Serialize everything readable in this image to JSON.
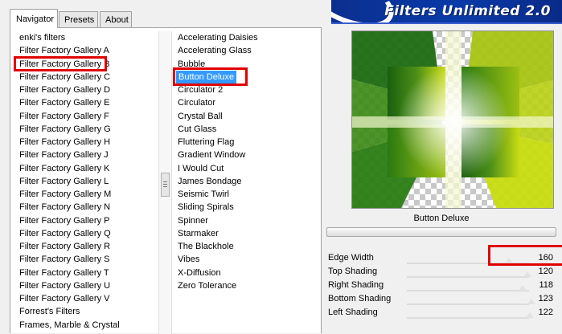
{
  "tabs": [
    {
      "label": "Navigator",
      "active": true
    },
    {
      "label": "Presets",
      "active": false
    },
    {
      "label": "About",
      "active": false
    }
  ],
  "banner": {
    "title": "Filters Unlimited 2.0"
  },
  "categories": [
    "enki's filters",
    "Filter Factory Gallery A",
    "Filter Factory Gallery B",
    "Filter Factory Gallery C",
    "Filter Factory Gallery D",
    "Filter Factory Gallery E",
    "Filter Factory Gallery F",
    "Filter Factory Gallery G",
    "Filter Factory Gallery H",
    "Filter Factory Gallery J",
    "Filter Factory Gallery K",
    "Filter Factory Gallery L",
    "Filter Factory Gallery M",
    "Filter Factory Gallery N",
    "Filter Factory Gallery P",
    "Filter Factory Gallery Q",
    "Filter Factory Gallery R",
    "Filter Factory Gallery S",
    "Filter Factory Gallery T",
    "Filter Factory Gallery U",
    "Filter Factory Gallery V",
    "Forrest's Filters",
    "Frames, Marble & Crystal"
  ],
  "selected_category": "Filter Factory Gallery B",
  "filters": [
    "Accelerating Daisies",
    "Accelerating Glass",
    "Bubble",
    "Button Deluxe",
    "Circulator 2",
    "Circulator",
    "Crystal Ball",
    "Cut Glass",
    "Fluttering Flag",
    "Gradient Window",
    "I Would Cut",
    "James Bondage",
    "Seismic Twirl",
    "Sliding Spirals",
    "Spinner",
    "Starmaker",
    "The Blackhole",
    "Vibes",
    "X-Diffusion",
    "Zero Tolerance"
  ],
  "selected_filter": "Button Deluxe",
  "effect_name": "Button Deluxe",
  "params": [
    {
      "label": "Edge Width",
      "value": "160"
    },
    {
      "label": "Top Shading",
      "value": "120"
    },
    {
      "label": "Right Shading",
      "value": "118"
    },
    {
      "label": "Bottom Shading",
      "value": "123"
    },
    {
      "label": "Left Shading",
      "value": "122"
    }
  ],
  "colors": {
    "selection": "#3399ff",
    "highlight_box": "#e00000",
    "banner_blue": "#0a3aa8",
    "preview_dark_green": "#1f6b12",
    "preview_lime": "#c8dc10"
  },
  "icons": {
    "scroll_thumb": "grip-lines-icon"
  }
}
